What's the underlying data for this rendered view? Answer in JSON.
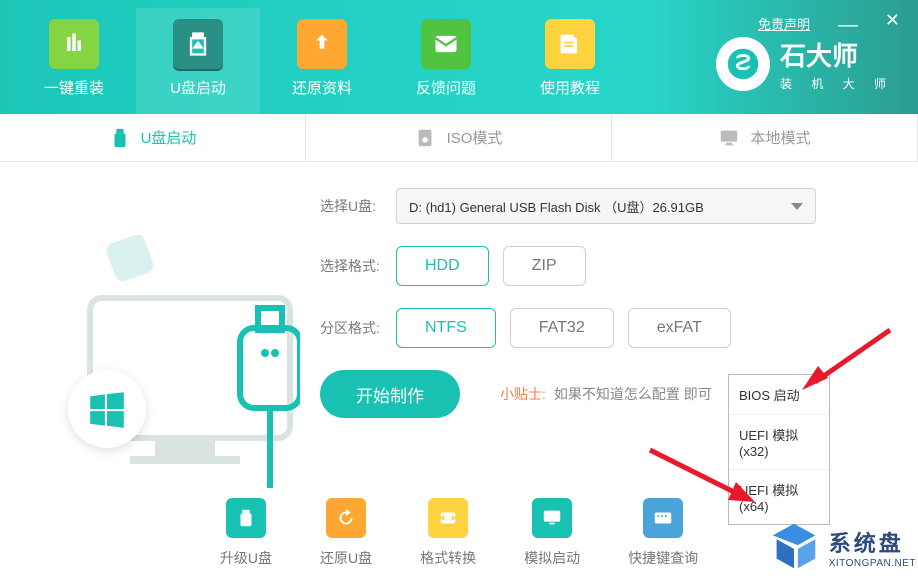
{
  "header": {
    "disclaimer": "免责声明",
    "nav": [
      {
        "label": "一键重装"
      },
      {
        "label": "U盘启动"
      },
      {
        "label": "还原资料"
      },
      {
        "label": "反馈问题"
      },
      {
        "label": "使用教程"
      }
    ],
    "brand_main": "石大师",
    "brand_sub": "装 机 大 师"
  },
  "tabs": {
    "usb": "U盘启动",
    "iso": "ISO模式",
    "local": "本地模式"
  },
  "form": {
    "select_usb_label": "选择U盘:",
    "select_usb_value": "D: (hd1) General USB Flash Disk （U盘）26.91GB",
    "format_label": "选择格式:",
    "format_opts": [
      "HDD",
      "ZIP"
    ],
    "partition_label": "分区格式:",
    "partition_opts": [
      "NTFS",
      "FAT32",
      "exFAT"
    ],
    "start_button": "开始制作",
    "tip_label": "小贴士:",
    "tip_text": "如果不知道怎么配置                 即可"
  },
  "popup": [
    "BIOS 启动",
    "UEFI 模拟(x32)",
    "UEFI 模拟(x64)"
  ],
  "tools": [
    "升级U盘",
    "还原U盘",
    "格式转换",
    "模拟启动",
    "快捷键查询"
  ],
  "watermark": {
    "main": "系统盘",
    "sub": "XITONGPAN.NET"
  },
  "colors": {
    "accent": "#19c1b2",
    "warn": "#ff7a45"
  }
}
